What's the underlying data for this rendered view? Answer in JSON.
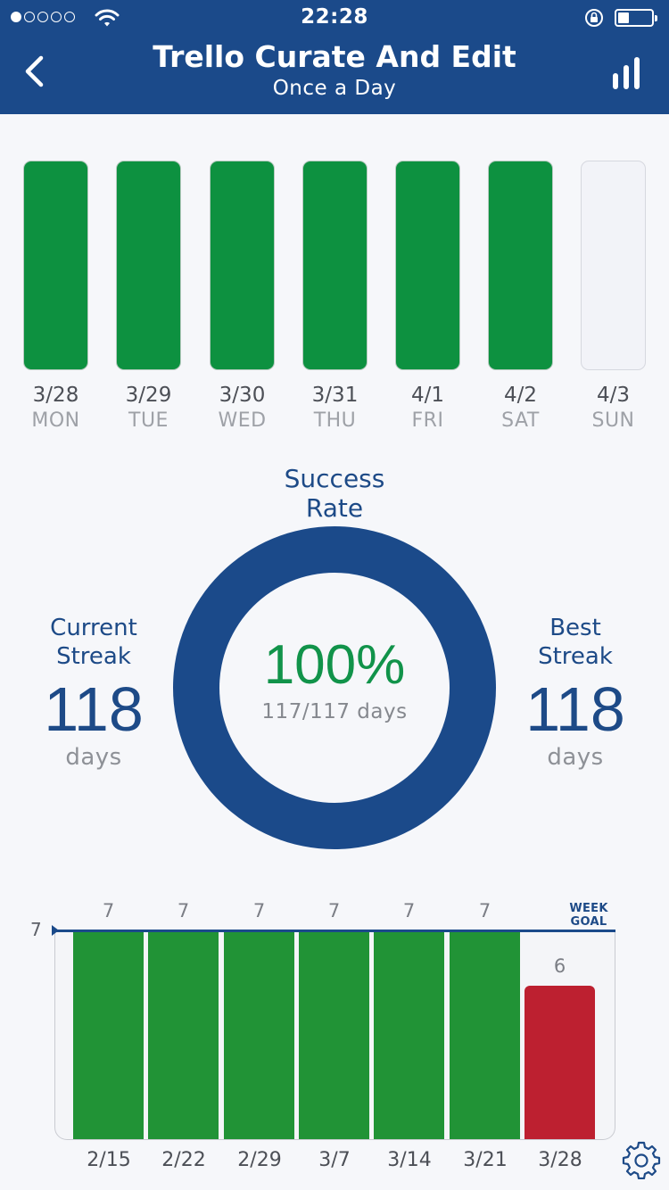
{
  "status_bar": {
    "time": "22:28",
    "signal_filled": 1,
    "signal_total": 5,
    "battery_level": 0.25
  },
  "header": {
    "title": "Trello Curate And Edit",
    "subtitle": "Once a Day",
    "back_icon": "chevron-left-icon",
    "stats_icon": "bar-chart-icon",
    "background_color": "#1b4a8a"
  },
  "week_days": [
    {
      "date": "3/28",
      "day": "MON",
      "done": true
    },
    {
      "date": "3/29",
      "day": "TUE",
      "done": true
    },
    {
      "date": "3/30",
      "day": "WED",
      "done": true
    },
    {
      "date": "3/31",
      "day": "THU",
      "done": true
    },
    {
      "date": "4/1",
      "day": "FRI",
      "done": true
    },
    {
      "date": "4/2",
      "day": "SAT",
      "done": true
    },
    {
      "date": "4/3",
      "day": "SUN",
      "done": false
    }
  ],
  "success": {
    "label": "Success Rate",
    "percent": "100%",
    "fraction": "117/117 days",
    "percent_color": "#11934a"
  },
  "current_streak": {
    "label": "Current Streak",
    "value": "118",
    "unit": "days"
  },
  "best_streak": {
    "label": "Best Streak",
    "value": "118",
    "unit": "days"
  },
  "weekly_chart": {
    "goal_value": "7",
    "goal_label": "WEEK GOAL",
    "met_color": "#219336",
    "missed_color": "#bd2030",
    "weeks": [
      {
        "date": "2/15",
        "value": 7
      },
      {
        "date": "2/22",
        "value": 7
      },
      {
        "date": "2/29",
        "value": 7
      },
      {
        "date": "3/7",
        "value": 7
      },
      {
        "date": "3/14",
        "value": 7
      },
      {
        "date": "3/21",
        "value": 7
      },
      {
        "date": "3/28",
        "value": 6
      }
    ]
  },
  "settings_icon": "gear-icon"
}
